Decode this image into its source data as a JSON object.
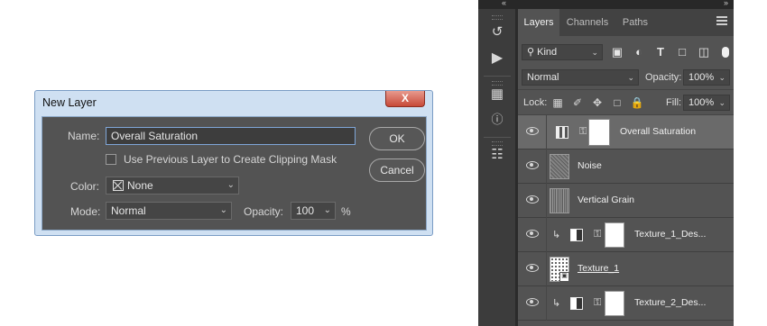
{
  "dialog": {
    "title": "New Layer",
    "close_label": "X",
    "name_label": "Name:",
    "name_value": "Overall Saturation",
    "clip_label": "Use Previous Layer to Create Clipping Mask",
    "color_label": "Color:",
    "color_value": "None",
    "mode_label": "Mode:",
    "mode_value": "Normal",
    "opacity_label": "Opacity:",
    "opacity_value": "100",
    "opacity_unit": "%",
    "ok_label": "OK",
    "cancel_label": "Cancel"
  },
  "panel": {
    "tabs": [
      {
        "label": "Layers"
      },
      {
        "label": "Channels"
      },
      {
        "label": "Paths"
      }
    ],
    "filter_kind": "Kind",
    "blend_mode": "Normal",
    "opacity_label": "Opacity:",
    "opacity_value": "100%",
    "lock_label": "Lock:",
    "fill_label": "Fill:",
    "fill_value": "100%",
    "layers": [
      {
        "name": "Overall Saturation"
      },
      {
        "name": "Noise"
      },
      {
        "name": "Vertical Grain"
      },
      {
        "name": "Texture_1_Des..."
      },
      {
        "name": "Texture_1"
      },
      {
        "name": "Texture_2_Des..."
      }
    ]
  },
  "colors": {
    "dialog_bg": "#535353",
    "panel_bg": "#535353",
    "selected_row": "#6a6a6a"
  }
}
